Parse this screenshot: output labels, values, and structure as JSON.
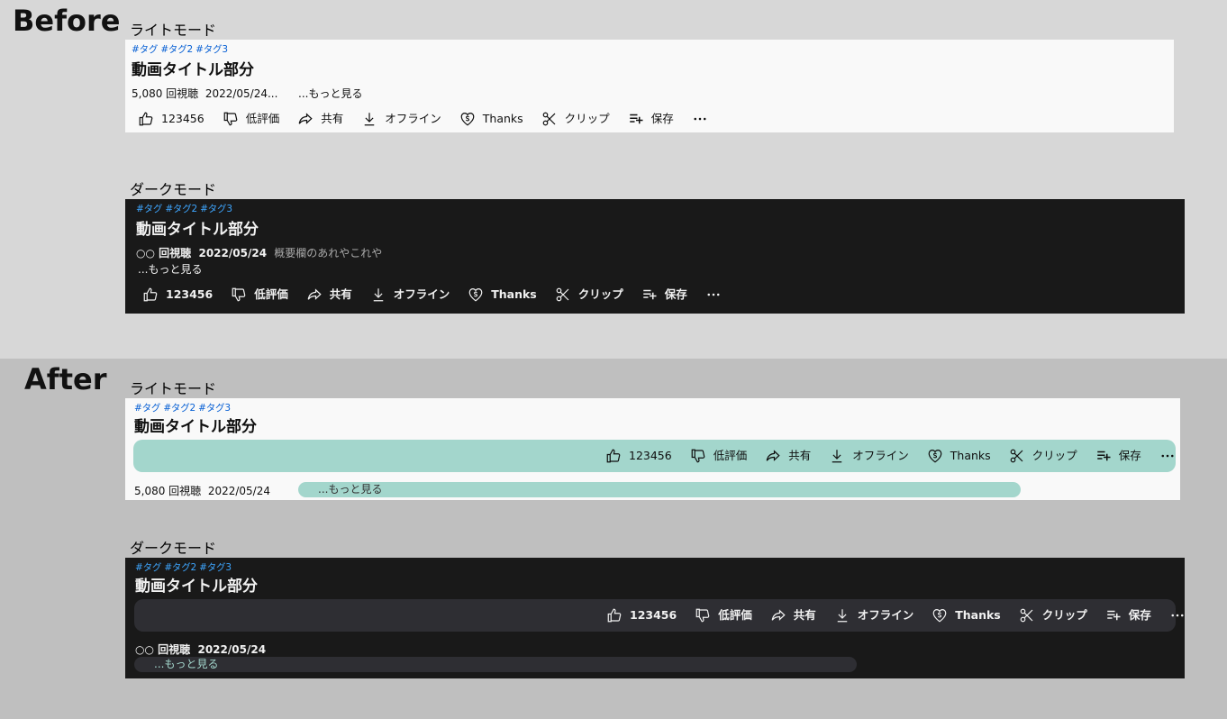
{
  "before": {
    "label": "Before",
    "light": {
      "mode_label": "ライトモード",
      "tags": "#タグ #タグ2 #タグ3",
      "title": "動画タイトル部分",
      "views": "5,080 回視聴",
      "date": "2022/05/24...",
      "more": "...もっと見る"
    },
    "dark": {
      "mode_label": "ダークモード",
      "tags": "#タグ #タグ2 #タグ3",
      "title": "動画タイトル部分",
      "views": "○○ 回視聴",
      "date": "2022/05/24",
      "description": "概要欄のあれやこれや",
      "more": "...もっと見る"
    }
  },
  "after": {
    "label": "After",
    "light": {
      "mode_label": "ライトモード",
      "tags": "#タグ #タグ2 #タグ3",
      "title": "動画タイトル部分",
      "views": "5,080 回視聴",
      "date": "2022/05/24",
      "more": "...もっと見る"
    },
    "dark": {
      "mode_label": "ダークモード",
      "tags": "#タグ #タグ2 #タグ3",
      "title": "動画タイトル部分",
      "views": "○○ 回視聴",
      "date": "2022/05/24",
      "more": "...もっと見る"
    }
  },
  "actions": {
    "like_count": "123456",
    "dislike": "低評価",
    "share": "共有",
    "offline": "オフライン",
    "thanks": "Thanks",
    "clip": "クリップ",
    "save": "保存",
    "more_icon": "more-horizontal-icon"
  },
  "colors": {
    "before_bg": "#d7d7d7",
    "after_bg": "#bfbfbf",
    "highlight_teal": "#a3d6cc",
    "dark_panel": "#191919",
    "dark_bar": "#2e2e33",
    "tag_blue_light": "#065fd4",
    "tag_blue_dark": "#3ea6ff"
  }
}
